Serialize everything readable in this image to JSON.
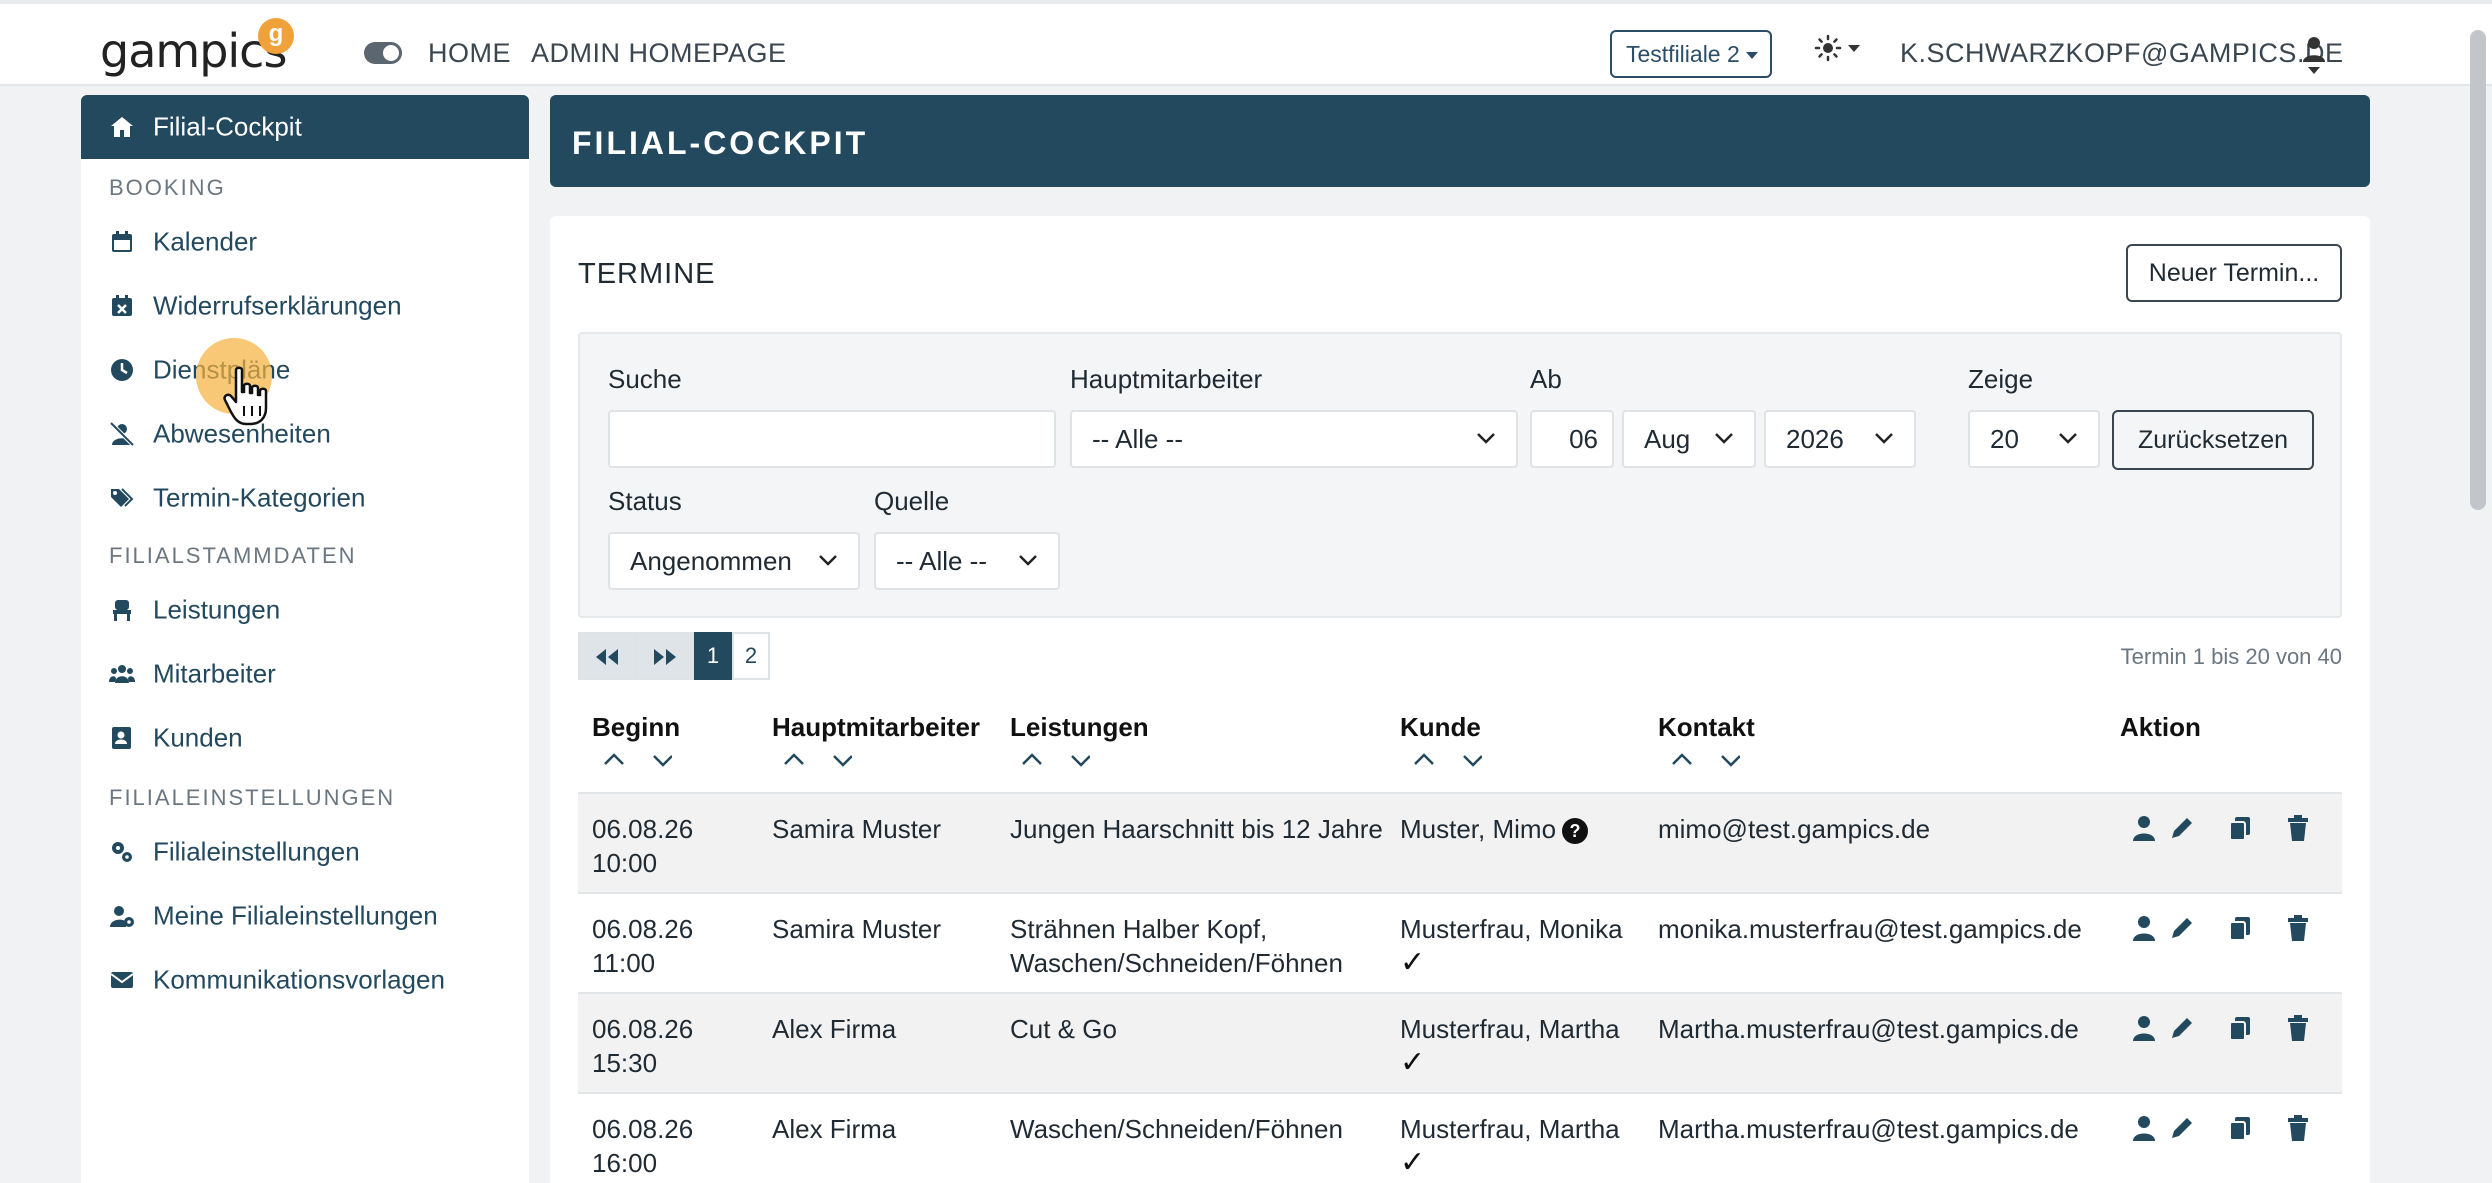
{
  "navbar": {
    "logo": "gampics",
    "logo_badge": "g",
    "links": [
      "HOME",
      "ADMIN HOMEPAGE"
    ],
    "filial": "Testfiliale 2",
    "user_email": "K.SCHWARZKOPF@GAMPICS.DE"
  },
  "sidebar": {
    "active": "Filial-Cockpit",
    "sections": [
      {
        "title": "BOOKING",
        "items": [
          "Kalender",
          "Widerrufserklärungen",
          "Dienstpläne",
          "Abwesenheiten",
          "Termin-Kategorien"
        ]
      },
      {
        "title": "FILIALSTAMMDATEN",
        "items": [
          "Leistungen",
          "Mitarbeiter",
          "Kunden"
        ]
      },
      {
        "title": "FILIALEINSTELLUNGEN",
        "items": [
          "Filialeinstellungen",
          "Meine Filialeinstellungen",
          "Kommunikationsvorlagen"
        ]
      }
    ]
  },
  "page": {
    "title": "FILIAL-COCKPIT",
    "card_title": "TERMINE",
    "new_button": "Neuer Termin..."
  },
  "filters": {
    "search_label": "Suche",
    "search_value": "",
    "employee_label": "Hauptmitarbeiter",
    "employee_value": "-- Alle --",
    "from_label": "Ab",
    "from_day": "06",
    "from_month": "Aug",
    "from_year": "2026",
    "show_label": "Zeige",
    "show_value": "20",
    "reset_button": "Zurücksetzen",
    "status_label": "Status",
    "status_value": "Angenommen",
    "source_label": "Quelle",
    "source_value": "-- Alle --"
  },
  "pagination": {
    "pages": [
      "1",
      "2"
    ],
    "current": "1",
    "info": "Termin 1 bis 20 von 40"
  },
  "table": {
    "headers": [
      "Beginn",
      "Hauptmitarbeiter",
      "Leistungen",
      "Kunde",
      "Kontakt",
      "Aktion"
    ],
    "rows": [
      {
        "date": "06.08.26",
        "time": "10:00",
        "employee": "Samira Muster",
        "service1": "Jungen Haarschnitt bis 12 Jahre",
        "service2": "",
        "customer": "Muster, Mimo",
        "contact": "mimo@test.gampics.de"
      },
      {
        "date": "06.08.26",
        "time": "11:00",
        "employee": "Samira Muster",
        "service1": "Strähnen Halber Kopf,",
        "service2": "Waschen/Schneiden/Föhnen",
        "customer": "Musterfrau, Monika",
        "contact": "monika.musterfrau@test.gampics.de"
      },
      {
        "date": "06.08.26",
        "time": "15:30",
        "employee": "Alex Firma",
        "service1": "Cut & Go",
        "service2": "",
        "customer": "Musterfrau, Martha",
        "contact": "Martha.musterfrau@test.gampics.de"
      },
      {
        "date": "06.08.26",
        "time": "16:00",
        "employee": "Alex Firma",
        "service1": "Waschen/Schneiden/Föhnen",
        "service2": "",
        "customer": "Musterfrau, Martha",
        "contact": "Martha.musterfrau@test.gampics.de"
      }
    ]
  },
  "colors": {
    "primary": "#23495f",
    "accent": "#f0a23a"
  }
}
